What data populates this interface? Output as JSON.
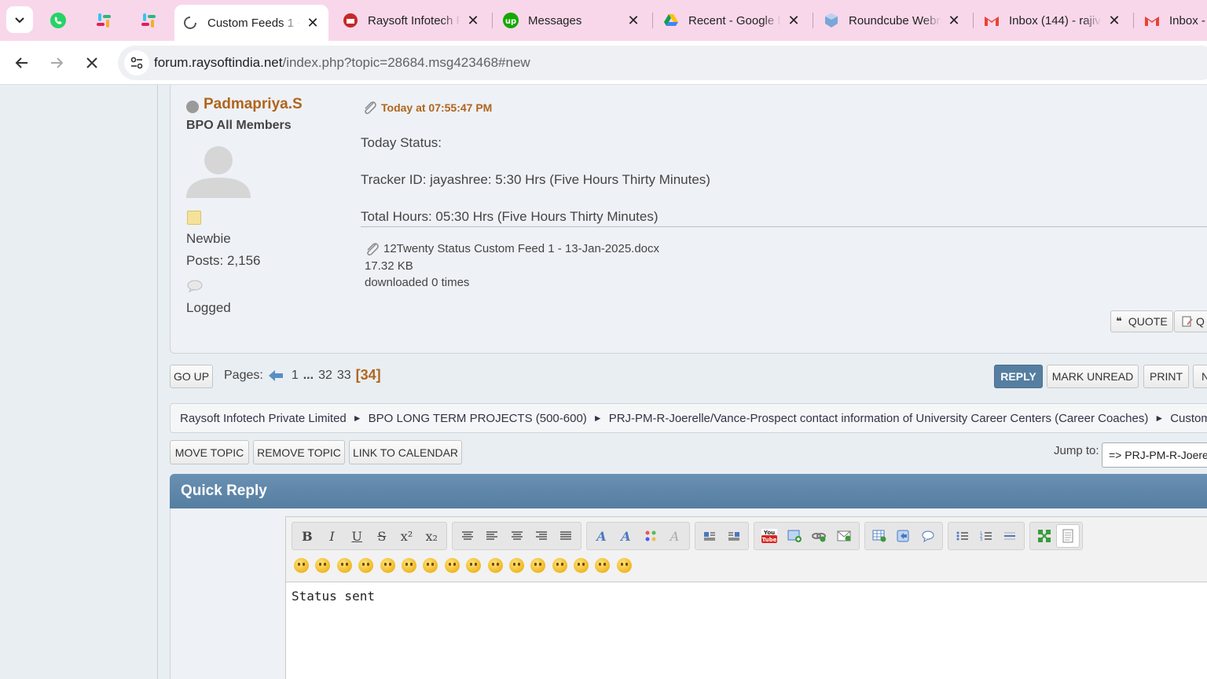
{
  "browser": {
    "tabs": [
      {
        "title": "Custom Feeds 1 -",
        "favicon": "loading-spinner-icon",
        "active": true
      },
      {
        "title": "Raysoft Infotech P",
        "favicon": "raysoft-icon"
      },
      {
        "title": "Messages",
        "favicon": "upwork-icon"
      },
      {
        "title": "Recent - Google D",
        "favicon": "google-drive-icon"
      },
      {
        "title": "Roundcube Webm",
        "favicon": "roundcube-icon"
      },
      {
        "title": "Inbox (144) - rajiv",
        "favicon": "gmail-icon"
      },
      {
        "title": "Inbox -",
        "favicon": "gmail-icon"
      }
    ],
    "pinned_tabs": [
      "whatsapp-icon",
      "slack-icon",
      "slack-icon"
    ],
    "url_host": "forum.raysoftindia.net",
    "url_path": "/index.php?topic=28684.msg423468#new"
  },
  "post": {
    "author": "Padmapriya.S",
    "group": "BPO All Members",
    "rank": "Newbie",
    "posts": "Posts: 2,156",
    "logged": "Logged",
    "time": "Today at 07:55:47 PM",
    "body_lines": [
      "Today Status:",
      "Tracker ID: jayashree: 5:30 Hrs (Five Hours Thirty Minutes)",
      "Total Hours: 05:30 Hrs (Five Hours Thirty Minutes)"
    ],
    "attachment": {
      "name": "12Twenty Status Custom Feed 1 - 13-Jan-2025.docx",
      "size": "17.32 KB",
      "downloads": "downloaded 0 times"
    },
    "quote_label": "QUOTE",
    "quick_label": "Q"
  },
  "pagination": {
    "go_up": "GO UP",
    "label": "Pages:",
    "pages": [
      "1",
      "...",
      "32",
      "33"
    ],
    "current": "[34]"
  },
  "actions": {
    "reply": "REPLY",
    "mark_unread": "MARK UNREAD",
    "print": "PRINT",
    "more": "N"
  },
  "breadcrumb": [
    "Raysoft Infotech Private Limited",
    "BPO LONG TERM PROJECTS (500-600)",
    "PRJ-PM-R-Joerelle/Vance-Prospect contact information of University Career Centers (Career Coaches)",
    "Custom Feeds"
  ],
  "moderation": {
    "move_topic": "MOVE TOPIC",
    "remove_topic": "REMOVE TOPIC",
    "link_calendar": "LINK TO CALENDAR"
  },
  "jump": {
    "label": "Jump to:",
    "value": "=> PRJ-PM-R-Joerelle"
  },
  "quick_reply": {
    "title": "Quick Reply",
    "text": "Status sent",
    "smiley_count": 16
  }
}
